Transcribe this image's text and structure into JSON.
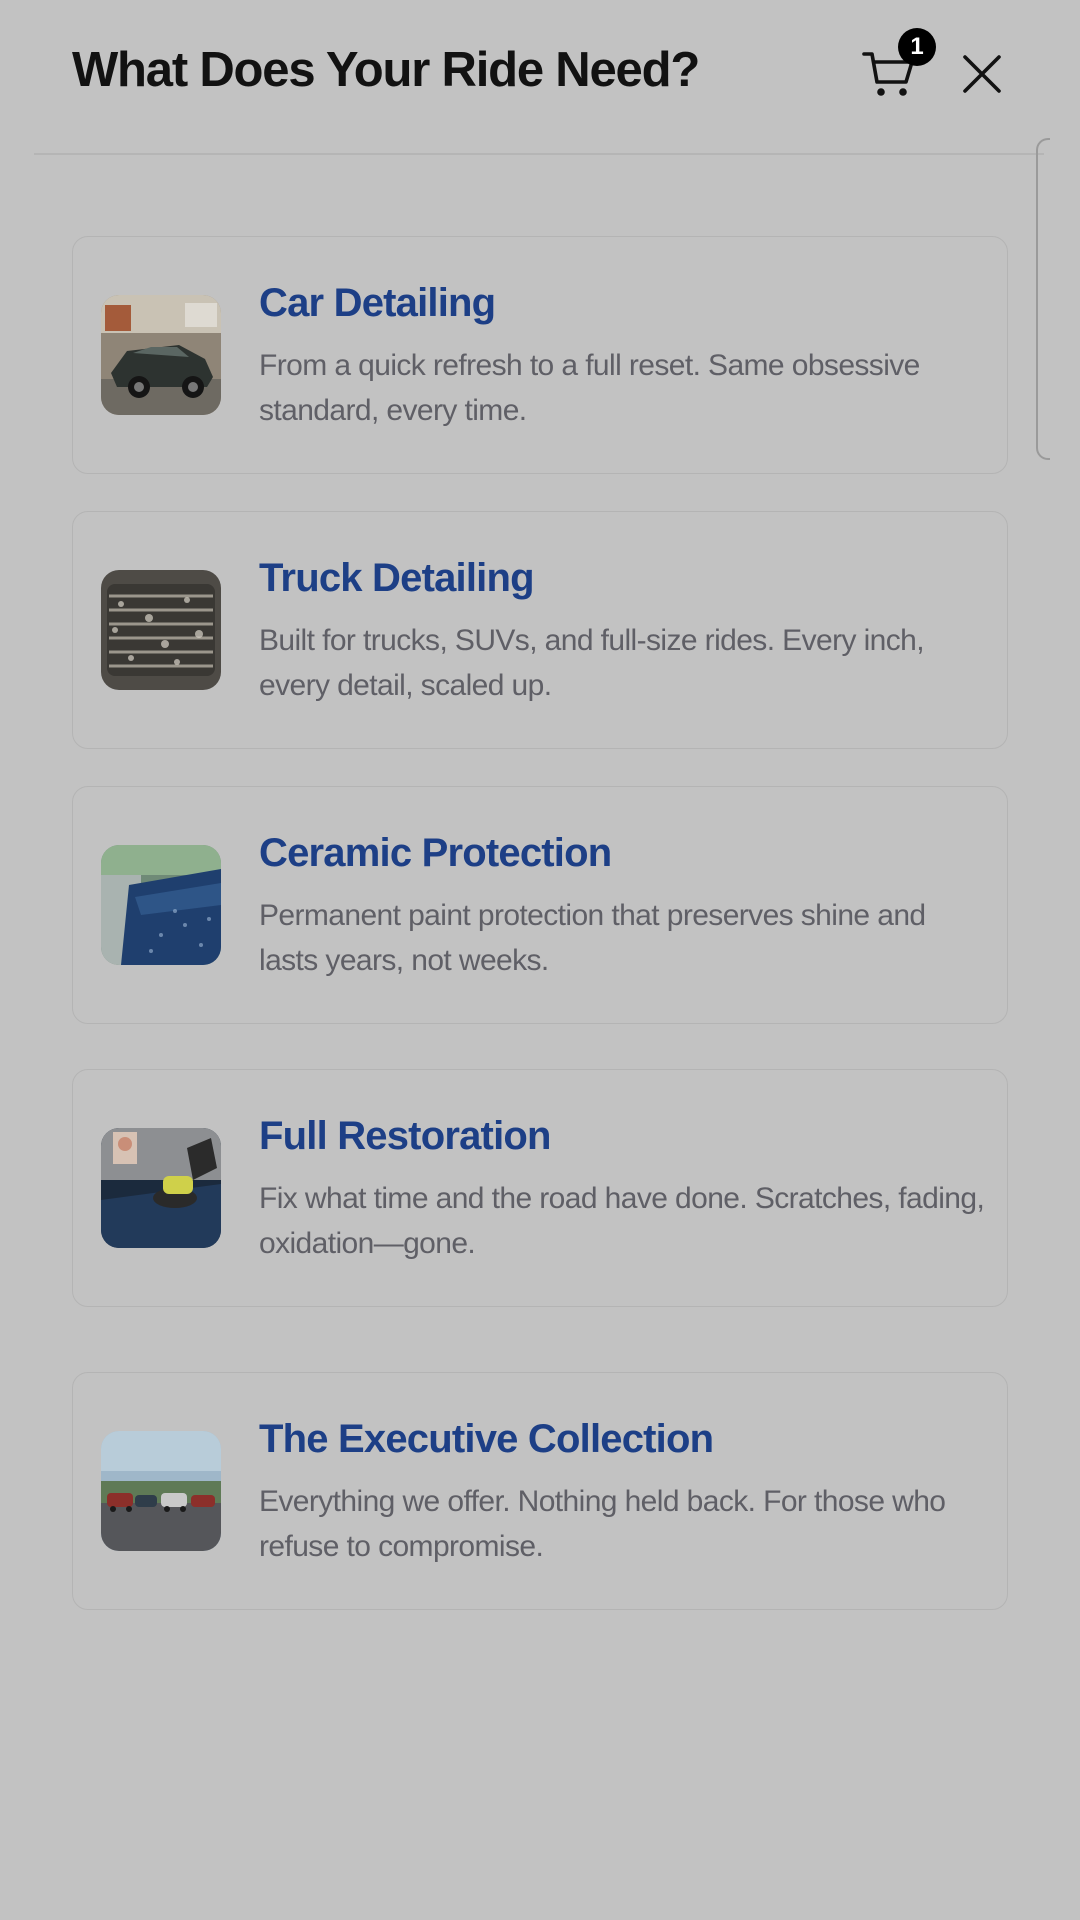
{
  "header": {
    "title": "What Does Your Ride Need?",
    "cart_count": "1"
  },
  "services": [
    {
      "title": "Car Detailing",
      "description": "From a quick refresh to a full reset. Same obsessive standard, every time.",
      "thumb_icon": "car-photo-thumbnail"
    },
    {
      "title": "Truck Detailing",
      "description": "Built for trucks, SUVs, and full-size rides. Every inch, every detail, scaled up.",
      "thumb_icon": "truck-grille-photo-thumbnail"
    },
    {
      "title": "Ceramic Protection",
      "description": "Permanent paint protection that preserves shine and lasts years, not weeks.",
      "thumb_icon": "ceramic-coating-photo-thumbnail"
    },
    {
      "title": "Full Restoration",
      "description": "Fix what time and the road have done. Scratches, fading, oxidation—gone.",
      "thumb_icon": "polishing-photo-thumbnail"
    },
    {
      "title": "The Executive Collection",
      "description": "Everything we offer. Nothing held back. For those who refuse to compromise.",
      "thumb_icon": "parking-lot-photo-thumbnail"
    }
  ],
  "colors": {
    "overlay_background": "#c2c2c2",
    "title": "#121212",
    "card_title": "#1d3f86",
    "card_description": "#5f5f66",
    "card_border": "#b4b4b4",
    "badge": "#000000"
  }
}
